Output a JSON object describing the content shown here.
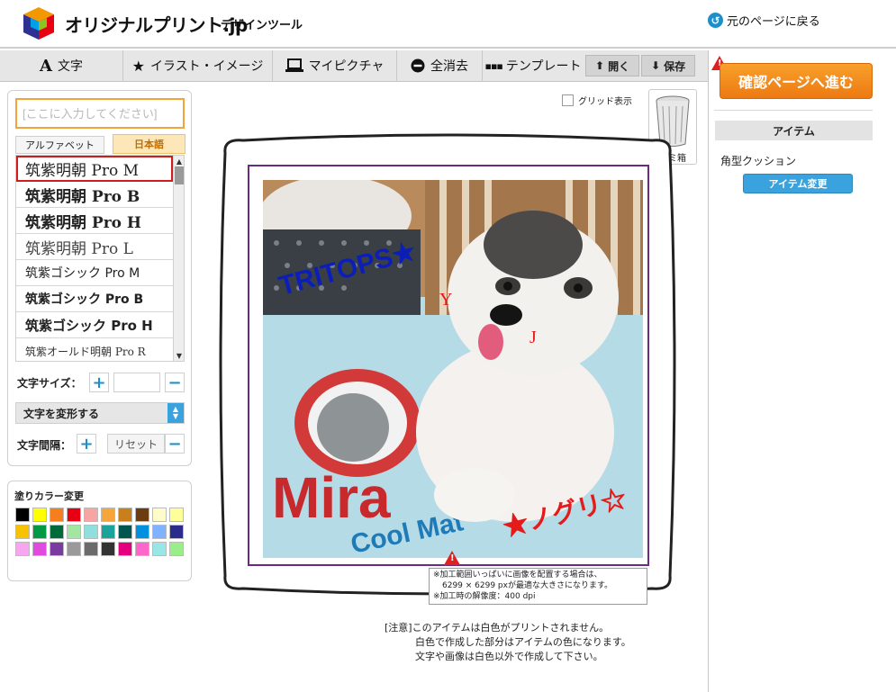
{
  "header": {
    "brand": "オリジナルプリント.jp",
    "subtitle": "デザインツール",
    "back_label": "元のページに戻る"
  },
  "toolbar": {
    "text_label": "文字",
    "illust_label": "イラスト・イメージ",
    "mypicture_label": "マイピクチャ",
    "clear_label": "全消去",
    "template_label": "テンプレート",
    "open_label": "開く",
    "save_label": "保存"
  },
  "left": {
    "input_placeholder": "[ここに入力してください]",
    "tab_alpha": "アルファベット",
    "tab_japanese": "日本語",
    "fonts": [
      "筑紫明朝 Pro M",
      "筑紫明朝 Pro B",
      "筑紫明朝 Pro H",
      "筑紫明朝 Pro L",
      "筑紫ゴシック Pro M",
      "筑紫ゴシック Pro B",
      "筑紫ゴシック Pro H",
      "筑紫オールド明朝 Pro R"
    ],
    "size_label": "文字サイズ：",
    "transform_label": "文字を変形する",
    "spacing_label": "文字間隔：",
    "reset_label": "リセット"
  },
  "colors": {
    "title": "塗りカラー変更",
    "swatches": [
      "#000000",
      "#ffff00",
      "#f57f1f",
      "#e60012",
      "#f6a4a4",
      "#f6a53a",
      "#c97f1a",
      "#6b3c12",
      "#fffcc9",
      "#ffff99",
      "#f7c300",
      "#009944",
      "#006b3a",
      "#a3e6a3",
      "#8fe0dc",
      "#1aa39a",
      "#00574f",
      "#0090e0",
      "#7fb3ff",
      "#2b2b8c",
      "#f7a6f0",
      "#e04adf",
      "#7a3aa0",
      "#9a9a9a",
      "#6b6b6b",
      "#333333",
      "#e4007f",
      "#ff66cc",
      "#99e6e6",
      "#99ee88"
    ]
  },
  "canvas": {
    "grid_label": "グリッド表示",
    "trash_label": "ゴミ箱",
    "photo_text_1": "TRITOPS★",
    "photo_text_2": "Y",
    "photo_text_3": "J",
    "photo_text_4": "★ノグリ☆",
    "print_note_1": "※加工範囲いっぱいに画像を配置する場合は、",
    "print_note_2": "6299 × 6299 pxが最適な大きさになります。",
    "print_note_3": "※加工時の解像度：400 dpi",
    "notice_1": "[注意]このアイテムは白色がプリントされません。",
    "notice_2": "白色で作成した部分はアイテムの色になります。",
    "notice_3": "文字や画像は白色以外で作成して下さい。"
  },
  "right": {
    "confirm_label": "確認ページへ進む",
    "item_heading": "アイテム",
    "item_name": "角型クッション",
    "item_change_label": "アイテム変更"
  }
}
